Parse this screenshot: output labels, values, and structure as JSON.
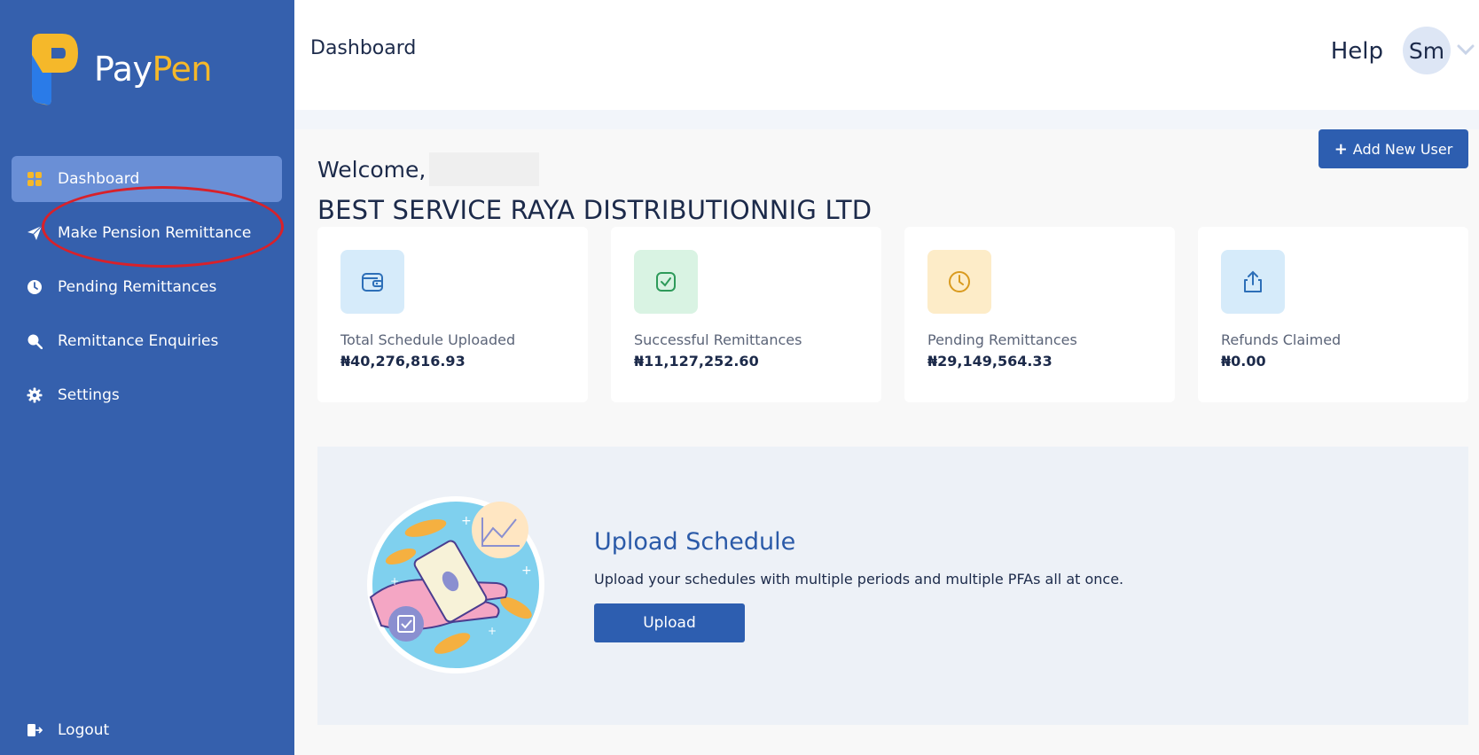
{
  "brand": {
    "name_part1": "Pay",
    "name_part2": "Pen",
    "accent_color": "#f5b82a",
    "sidebar_color": "#3560ad"
  },
  "sidebar": {
    "items": [
      {
        "label": "Dashboard",
        "icon": "grid-icon",
        "active": true
      },
      {
        "label": "Make Pension Remittance",
        "icon": "paper-plane-icon",
        "active": false
      },
      {
        "label": "Pending Remittances",
        "icon": "clock-icon",
        "active": false
      },
      {
        "label": "Remittance Enquiries",
        "icon": "search-icon",
        "active": false
      },
      {
        "label": "Settings",
        "icon": "gear-icon",
        "active": false
      }
    ],
    "logout_label": "Logout"
  },
  "header": {
    "title": "Dashboard",
    "help_label": "Help",
    "avatar_initials": "Sm"
  },
  "main": {
    "welcome_label": "Welcome,",
    "company_name": "BEST SERVICE RAYA DISTRIBUTIONNIG LTD",
    "add_user_label": "Add New User",
    "cards": [
      {
        "label": "Total Schedule Uploaded",
        "value": "₦40,276,816.93",
        "icon": "wallet-icon",
        "tint": "#d6ebfa",
        "color": "#2d6fb8"
      },
      {
        "label": "Successful Remittances",
        "value": "₦11,127,252.60",
        "icon": "check-square-icon",
        "tint": "#d9f3e3",
        "color": "#2e9a5a"
      },
      {
        "label": "Pending Remittances",
        "value": "₦29,149,564.33",
        "icon": "clock-icon",
        "tint": "#fdecc8",
        "color": "#d99a1e"
      },
      {
        "label": "Refunds Claimed",
        "value": "₦0.00",
        "icon": "share-upload-icon",
        "tint": "#d6ebfa",
        "color": "#2d6fb8"
      }
    ],
    "upload": {
      "title": "Upload Schedule",
      "description": "Upload your schedules with multiple periods and multiple PFAs all at once.",
      "button_label": "Upload"
    }
  }
}
